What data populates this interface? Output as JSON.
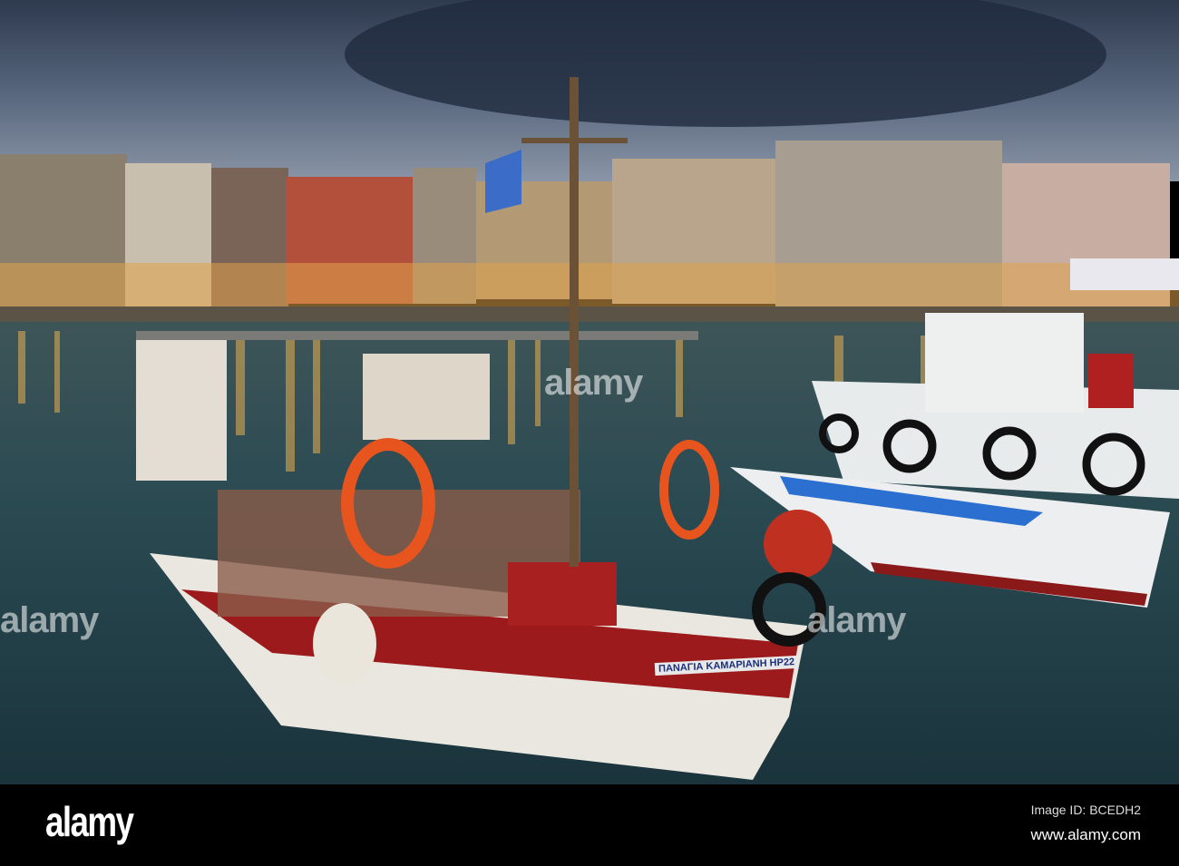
{
  "photo": {
    "subject": "harbour",
    "boat_name": "ΠΑΝΑΓΙΑ ΚΑΜΑΡΙΑΝΗ ΗΡ22",
    "watermark": "alamy"
  },
  "footer": {
    "logo": "alamy",
    "image_id": "Image ID: BCEDH2",
    "website": "www.alamy.com"
  },
  "colors": {
    "sky": "#3d4a5e",
    "water": "#25424a",
    "hull_red": "#9c1a1c",
    "hull_white": "#e9e6df",
    "footer": "#000000"
  }
}
